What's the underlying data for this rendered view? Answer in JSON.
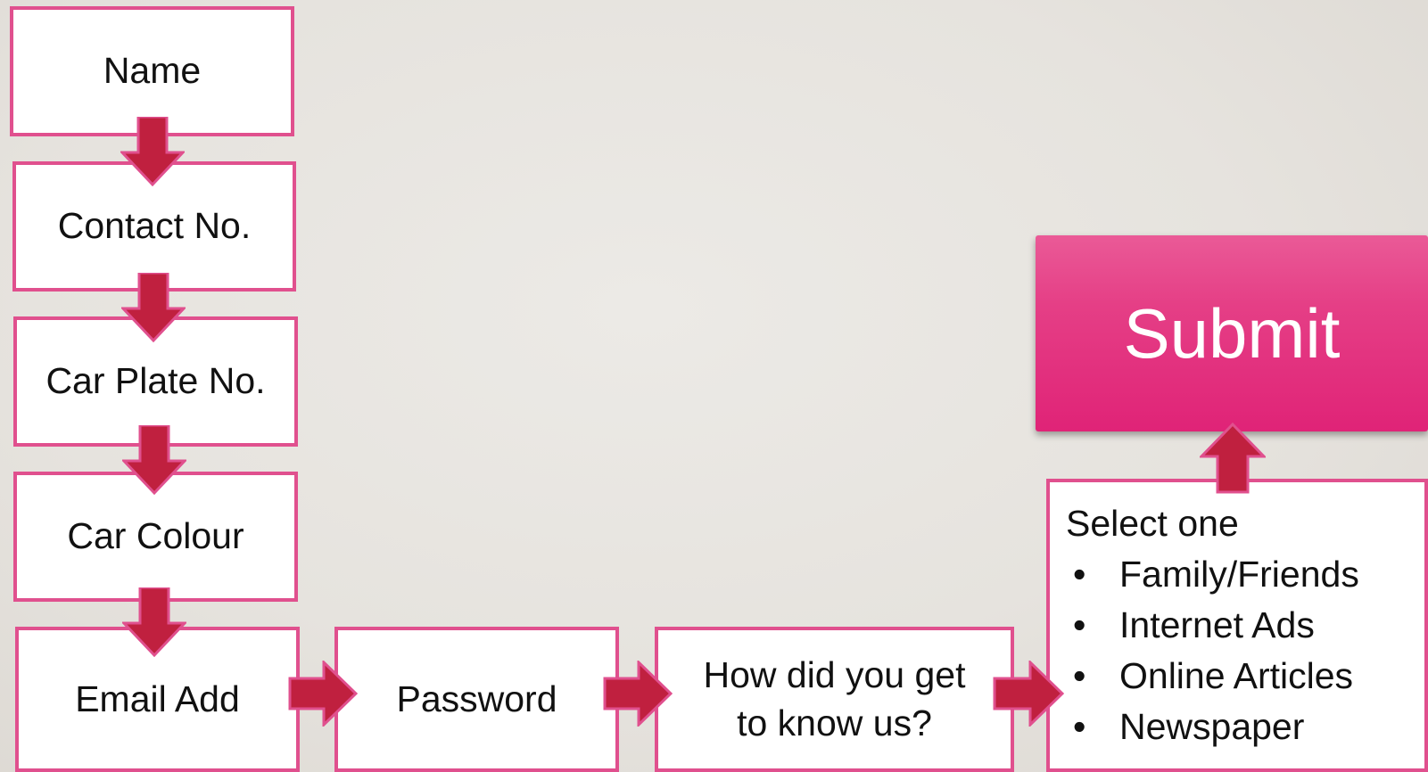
{
  "colors": {
    "box_border": "#e0508e",
    "arrow_fill": "#c0203f",
    "arrow_stroke": "#e0508e",
    "submit_bg": "#e53f86",
    "background": "#e6e3de"
  },
  "fields": {
    "name": "Name",
    "contact": "Contact No.",
    "car_plate": "Car Plate No.",
    "car_colour": "Car Colour",
    "email": "Email Add",
    "password": "Password",
    "how_heard_line1": "How did you get",
    "how_heard_line2": "to know us?"
  },
  "select_one": {
    "title": "Select one",
    "bullet": "•",
    "options": [
      "Family/Friends",
      "Internet Ads",
      "Online Articles",
      "Newspaper"
    ]
  },
  "submit": {
    "label": "Submit"
  },
  "arrows": [
    {
      "name": "arrow-down-1",
      "icon": "arrow-down-icon"
    },
    {
      "name": "arrow-down-2",
      "icon": "arrow-down-icon"
    },
    {
      "name": "arrow-down-3",
      "icon": "arrow-down-icon"
    },
    {
      "name": "arrow-down-4",
      "icon": "arrow-down-icon"
    },
    {
      "name": "arrow-right-1",
      "icon": "arrow-right-icon"
    },
    {
      "name": "arrow-right-2",
      "icon": "arrow-right-icon"
    },
    {
      "name": "arrow-right-3",
      "icon": "arrow-right-icon"
    },
    {
      "name": "arrow-up-1",
      "icon": "arrow-up-icon"
    }
  ]
}
